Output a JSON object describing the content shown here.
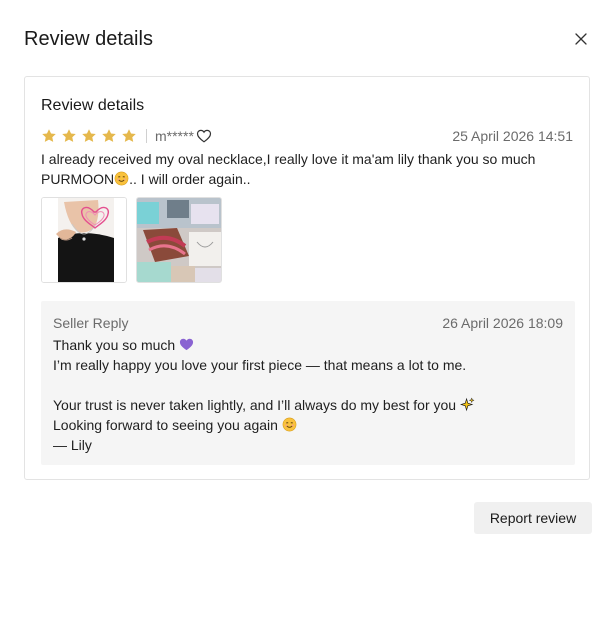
{
  "modal": {
    "title": "Review details",
    "close_icon": "close-icon"
  },
  "review": {
    "section_title": "Review details",
    "rating": 5,
    "rating_max": 5,
    "reviewer": "m*****",
    "date": "25 April 2026 14:51",
    "text_part1": "I already received my oval necklace,I really love it ma'am lily thank you so much PURMOON",
    "text_part2": ".. I will order again..",
    "photos": [
      {
        "icon": "necklace-photo-thumbnail"
      },
      {
        "icon": "package-photo-thumbnail"
      }
    ]
  },
  "seller_reply": {
    "label": "Seller Reply",
    "date": "26 April 2026 18:09",
    "line1": "Thank you so much ",
    "line2": "I’m really happy you love your first piece — that means a lot to me.",
    "line3": "Your trust is never taken lightly, and I’ll always do my best for you ",
    "line4": "Looking forward to seeing you again ",
    "line5": "— Lily"
  },
  "actions": {
    "report_label": "Report review"
  },
  "colors": {
    "star": "#e5b84c",
    "reply_bg": "#f5f5f5",
    "heart_purple": "#8a63d2"
  }
}
